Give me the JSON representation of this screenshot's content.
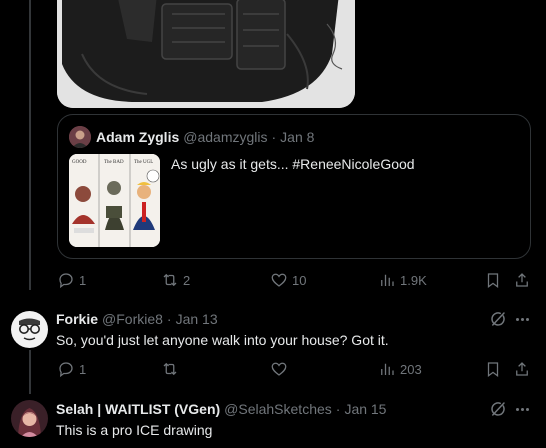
{
  "quoted_tweet": {
    "author_name": "Adam Zyglis",
    "author_handle": "@adamzyglis",
    "separator": "·",
    "date": "Jan 8",
    "text": "As ugly as it gets... #ReneeNicoleGood",
    "thumbnail_labels": [
      "GOOD",
      "The BAD",
      "The UGL"
    ]
  },
  "main_actions": {
    "replies": "1",
    "reposts": "2",
    "likes": "10",
    "views": "1.9K"
  },
  "replies": [
    {
      "name": "Forkie",
      "handle": "@Forkie8",
      "separator": "·",
      "date": "Jan 13",
      "text": "So, you'd just let anyone walk into your house?  Got it.",
      "actions": {
        "replies": "1",
        "reposts": "",
        "likes": "",
        "views": "203"
      }
    },
    {
      "name": "Selah | WAITLIST (VGen)",
      "handle": "@SelahSketches",
      "separator": "·",
      "date": "Jan 15",
      "text": "This is a pro ICE drawing"
    }
  ],
  "colors": {
    "background": "#000000",
    "text_primary": "#e7e9ea",
    "text_secondary": "#71767b",
    "border": "#2f3336"
  }
}
